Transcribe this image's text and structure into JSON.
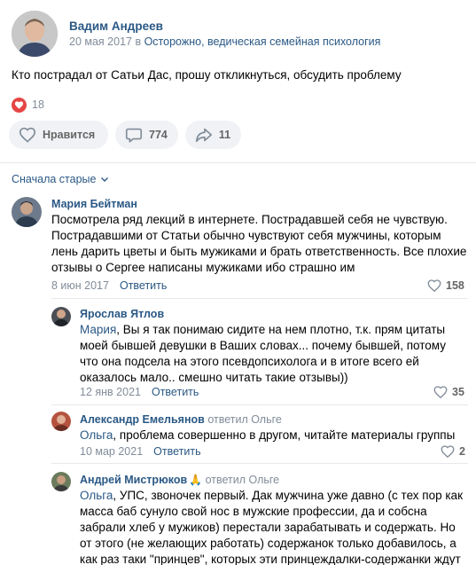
{
  "post": {
    "author": "Вадим Андреев",
    "date": "20 мая 2017 в",
    "group": "Осторожно, ведическая семейная психология",
    "text": "Кто пострадал от Сатьи Дас, прошу откликнуться, обсудить проблему",
    "reactions_count": "18",
    "like_label": "Нравится",
    "comments_count": "774",
    "shares_count": "11"
  },
  "comments_section": {
    "sort_label": "Сначала старые"
  },
  "comments": [
    {
      "author": "Мария Бейтман",
      "text": "Посмотрела ряд лекций в интернете. Пострадавшей себя не чувствую. Пострадавшими от Статьи обычно чувствуют себя мужчины, которым лень дарить цветы и быть мужиками и брать ответственность. Все плохие отзывы о Сергее написаны мужиками ибо страшно им",
      "date": "8 июн 2017",
      "reply_label": "Ответить",
      "likes": "158"
    },
    {
      "author": "Ярослав Ятлов",
      "mention": "Мария",
      "text": ", Вы я так понимаю сидите на нем плотно, т.к. прям цитаты моей бывшей девушки в Ваших словах... почему бывшей, потому что она подсела на этого псевдопсихолога и в итоге всего ей оказалось мало.. смешно читать такие отзывы))",
      "date": "12 янв 2021",
      "reply_label": "Ответить",
      "likes": "35"
    },
    {
      "author": "Александр Емельянов",
      "replied_to": "ответил Ольге",
      "mention": "Ольга",
      "text": ", проблема совершенно в другом, читайте материалы группы",
      "date": "10 мар 2021",
      "reply_label": "Ответить",
      "likes": "2"
    },
    {
      "author": "Андрей Мистрюков",
      "emoji": "🙏",
      "replied_to": "ответил Ольге",
      "mention": "Ольга",
      "text": ", УПС, звоночек первый. Дак мужчина уже давно (с тех пор как масса баб сунуло свой нос в мужские профессии, да и собсна забрали хлеб у мужиков) перестали зарабатывать и содержать. Но от этого (не желающих работать) содержанок только добавилось, а как раз таки \"принцев\", которых эти принцеждалки-содержанки ждут давно"
    }
  ],
  "colors": {
    "link": "#2a5885",
    "muted": "#818c99",
    "heart": "#e64646",
    "button_bg": "#f0f2f5"
  },
  "icons": {
    "like": "heart-outline-icon",
    "comment": "comment-bubble-icon",
    "share": "share-arrow-icon",
    "reactions": "heart-filled-icon",
    "sort": "chevron-down-icon"
  }
}
